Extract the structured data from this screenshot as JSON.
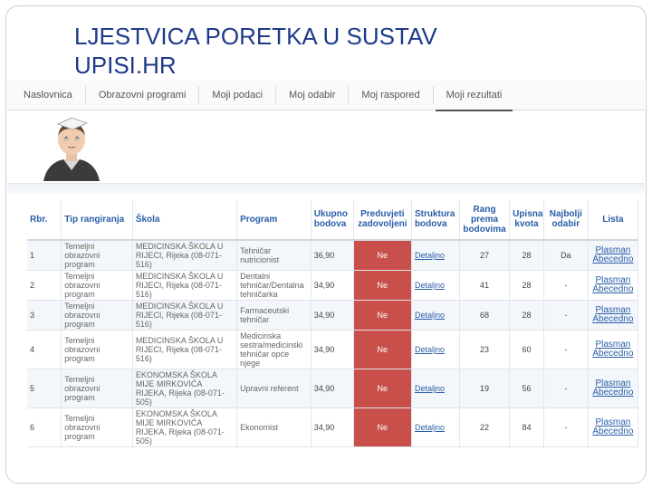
{
  "slide": {
    "title": "LJESTVICA PORETKA U SUSTAV UPISI.HR"
  },
  "nav": {
    "items": [
      {
        "label": "Naslovnica"
      },
      {
        "label": "Obrazovni programi"
      },
      {
        "label": "Moji podaci"
      },
      {
        "label": "Moj odabir"
      },
      {
        "label": "Moj raspored"
      },
      {
        "label": "Moji rezultati",
        "active": true
      }
    ]
  },
  "table": {
    "headers": {
      "rbr": "Rbr.",
      "tip": "Tip rangiranja",
      "skola": "Škola",
      "program": "Program",
      "ukupno": "Ukupno bodova",
      "preduvjeti": "Preduvjeti zadovoljeni",
      "struktura": "Struktura bodova",
      "rang": "Rang prema bodovima",
      "kvota": "Upisna kvota",
      "najbolji": "Najbolji odabir",
      "lista": "Lista"
    },
    "rows": [
      {
        "rbr": "1",
        "tip": "Temeljni obrazovni program",
        "skola": "MEDICINSKA ŠKOLA U RIJECI, Rijeka (08-071-516)",
        "program": "Tehničar nutricionist",
        "ukupno": "36,90",
        "preduvjeti": "Ne",
        "struktura": "Detaljno",
        "rang": "27",
        "kvota": "28",
        "najbolji": "Da",
        "lista1": "Plasman",
        "lista2": "Abecedno"
      },
      {
        "rbr": "2",
        "tip": "Temeljni obrazovni program",
        "skola": "MEDICINSKA ŠKOLA U RIJECI, Rijeka (08-071-516)",
        "program": "Dentalni tehničar/Dentalna tehničarka",
        "ukupno": "34,90",
        "preduvjeti": "Ne",
        "struktura": "Detaljno",
        "rang": "41",
        "kvota": "28",
        "najbolji": "-",
        "lista1": "Plasman",
        "lista2": "Abecedno"
      },
      {
        "rbr": "3",
        "tip": "Temeljni obrazovni program",
        "skola": "MEDICINSKA ŠKOLA U RIJECI, Rijeka (08-071-516)",
        "program": "Farmaceutski tehničar",
        "ukupno": "34,90",
        "preduvjeti": "Ne",
        "struktura": "Detaljno",
        "rang": "68",
        "kvota": "28",
        "najbolji": "-",
        "lista1": "Plasman",
        "lista2": "Abecedno"
      },
      {
        "rbr": "4",
        "tip": "Temeljni obrazovni program",
        "skola": "MEDICINSKA ŠKOLA U RIJECI, Rijeka (08-071-516)",
        "program": "Medicinska sestra/medicinski tehničar opće njege",
        "ukupno": "34,90",
        "preduvjeti": "Ne",
        "struktura": "Detaljno",
        "rang": "23",
        "kvota": "60",
        "najbolji": "-",
        "lista1": "Plasman",
        "lista2": "Abecedno"
      },
      {
        "rbr": "5",
        "tip": "Temeljni obrazovni program",
        "skola": "EKONOMSKA ŠKOLA MIJE MIRKOVIĆA RIJEKA, Rijeka (08-071-505)",
        "program": "Upravni referent",
        "ukupno": "34,90",
        "preduvjeti": "Ne",
        "struktura": "Detaljno",
        "rang": "19",
        "kvota": "56",
        "najbolji": "-",
        "lista1": "Plasman",
        "lista2": "Abecedno"
      },
      {
        "rbr": "6",
        "tip": "Temeljni obrazovni program",
        "skola": "EKONOMSKA ŠKOLA MIJE MIRKOVIĆA RIJEKA, Rijeka (08-071-505)",
        "program": "Ekonomist",
        "ukupno": "34,90",
        "preduvjeti": "Ne",
        "struktura": "Detaljno",
        "rang": "22",
        "kvota": "84",
        "najbolji": "-",
        "lista1": "Plasman",
        "lista2": "Abecedno"
      }
    ]
  },
  "colors": {
    "title": "#1f3a8a",
    "header_text": "#2a5ea8",
    "fail": "#c9504a",
    "link": "#2a5ea8"
  },
  "icons": {
    "avatar": "student-avatar-icon"
  }
}
